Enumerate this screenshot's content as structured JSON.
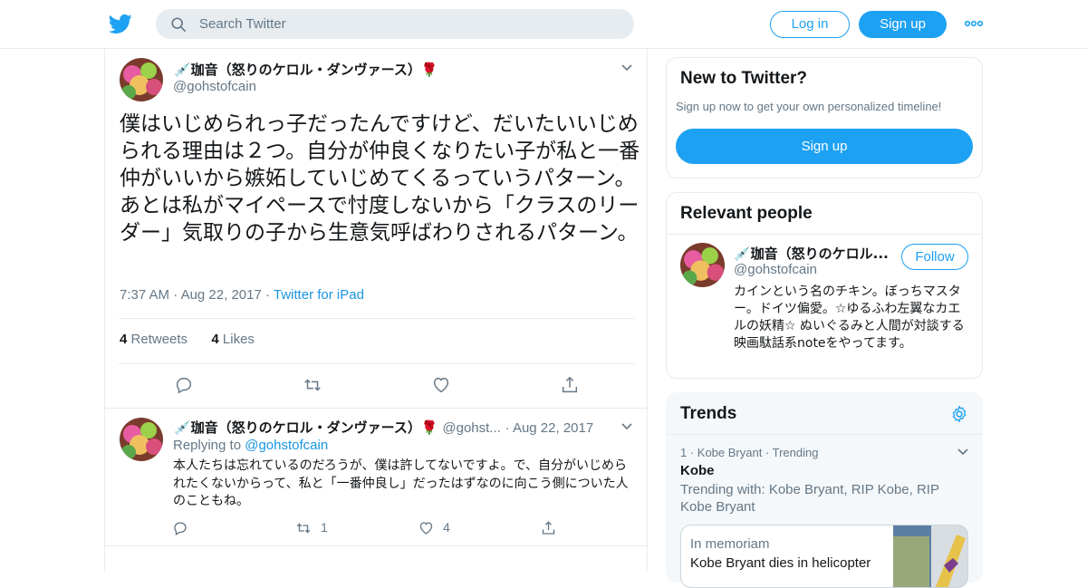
{
  "header": {
    "search_placeholder": "Search Twitter",
    "login_label": "Log in",
    "signup_label": "Sign up"
  },
  "main_tweet": {
    "display_name": "💉珈音（怒りのケロル・ダンヴァース）🌹",
    "handle": "@gohstofcain",
    "text": "僕はいじめられっ子だったんですけど、だいたいいじめられる理由は２つ。自分が仲良くなりたい子が私と一番仲がいいから嫉妬していじめてくるっていうパターン。あとは私がマイペースで忖度しないから「クラスのリーダー」気取りの子から生意気呼ばわりされるパターン。",
    "time": "7:37 AM",
    "date": "Aug 22, 2017",
    "source": "Twitter for iPad",
    "retweets_count": "4",
    "retweets_label": "Retweets",
    "likes_count": "4",
    "likes_label": "Likes"
  },
  "reply_tweet": {
    "display_name": "💉珈音（怒りのケロル・ダンヴァース）🌹",
    "handle_short": "@gohst...",
    "date": "Aug 22, 2017",
    "replying_prefix": "Replying to",
    "replying_handle": "@gohstofcain",
    "text": "本人たちは忘れているのだろうが、僕は許してないですよ。で、自分がいじめられたくないからって、私と「一番仲良し」だったはずなのに向こう側についた人のこともね。",
    "retweet_count": "1",
    "like_count": "4"
  },
  "new_to_twitter": {
    "title": "New to Twitter?",
    "subtitle": "Sign up now to get your own personalized timeline!",
    "signup_label": "Sign up"
  },
  "relevant_people": {
    "title": "Relevant people",
    "name": "💉珈音（怒りのケロル...",
    "handle": "@gohstofcain",
    "follow_label": "Follow",
    "bio": "カインという名のチキン。ぼっちマスター。ドイツ偏愛。☆ゆるふわ左翼なカエルの妖精☆ ぬいぐるみと人間が対談する映画駄話系noteをやってます。"
  },
  "trends": {
    "title": "Trends",
    "items": [
      {
        "meta": "1 · Kobe Bryant · Trending",
        "name": "Kobe",
        "trending_with": "Trending with: Kobe Bryant, RIP Kobe, RIP Kobe Bryant"
      }
    ],
    "card": {
      "label": "In memoriam",
      "headline": "Kobe Bryant dies in helicopter"
    }
  },
  "colors": {
    "accent": "#1da1f2",
    "link": "#1b95e0",
    "secondary_text": "#657786",
    "border": "#e6ecf0"
  },
  "icons": [
    "twitter-bird-icon",
    "search-icon",
    "more-dots-icon",
    "chevron-down-icon",
    "reply-icon",
    "retweet-icon",
    "like-icon",
    "share-icon",
    "gear-icon"
  ]
}
